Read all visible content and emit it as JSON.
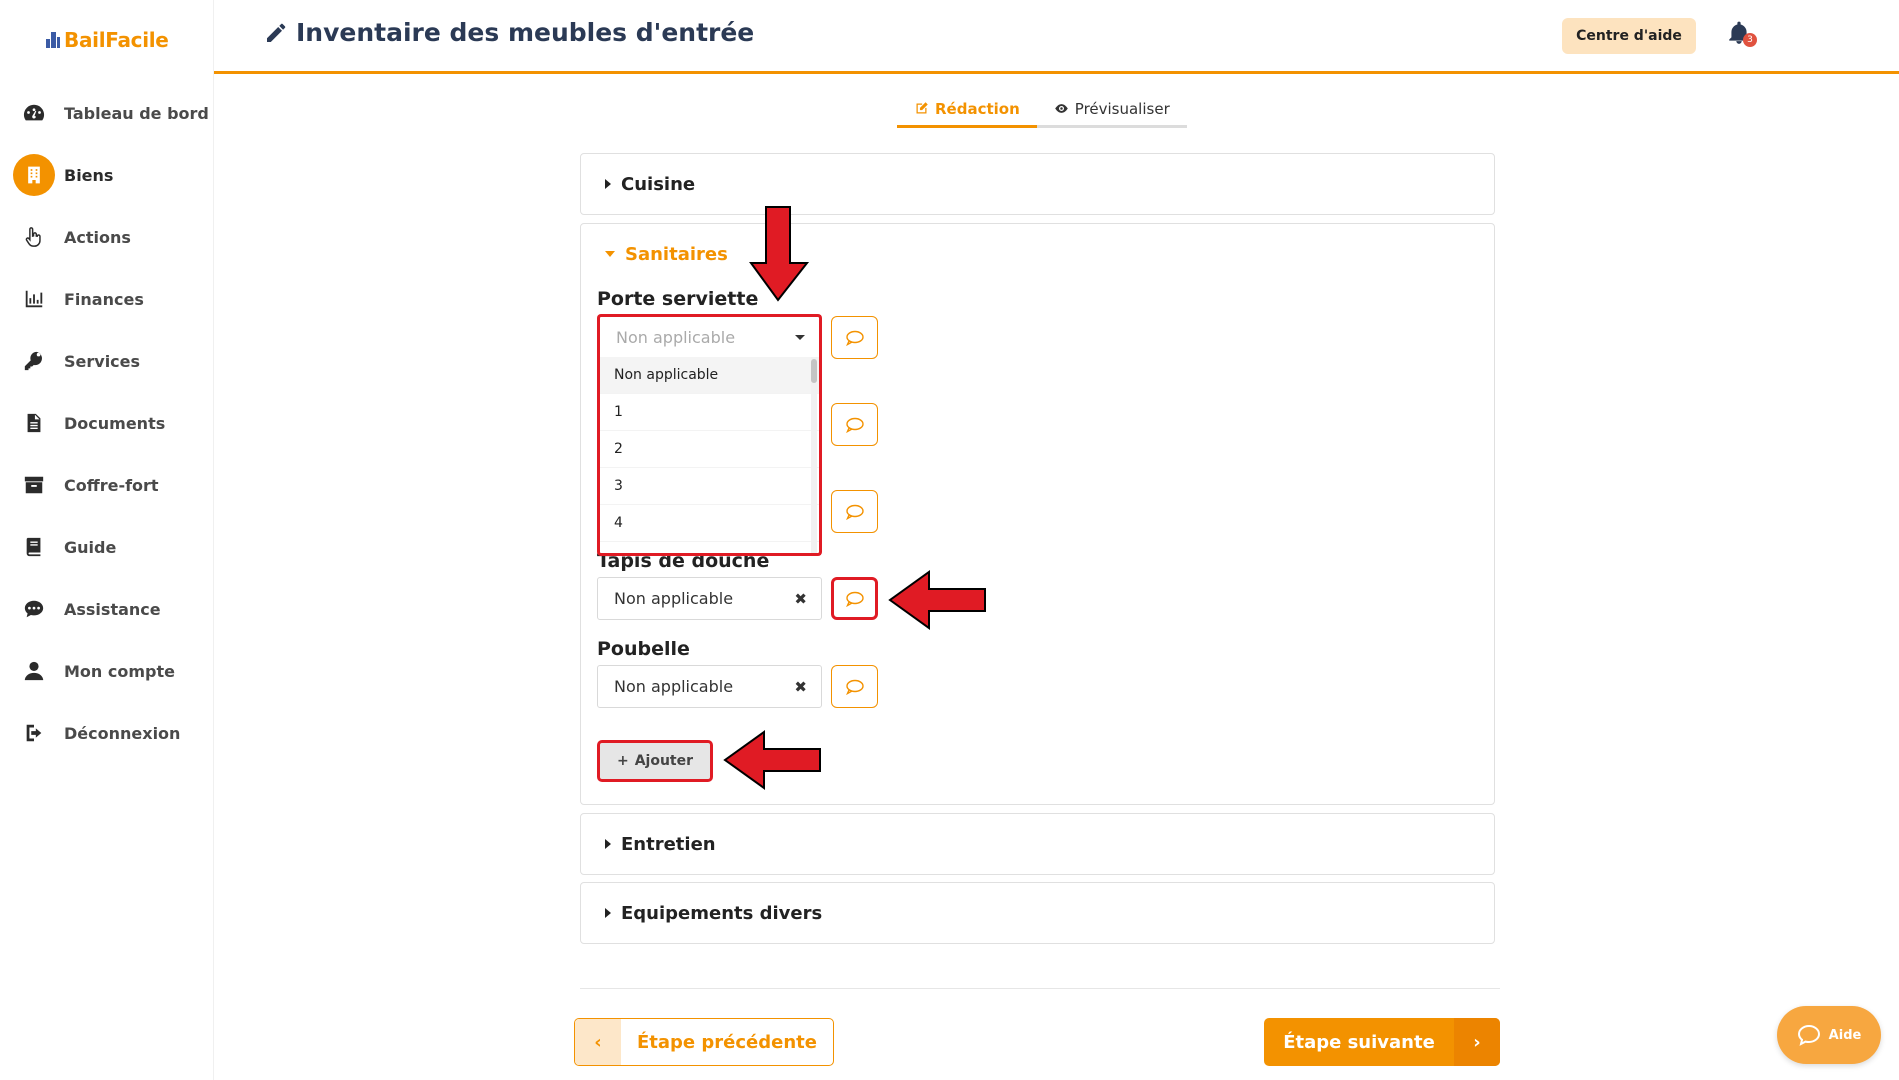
{
  "app": {
    "logo_text": "BailFacile"
  },
  "sidebar": {
    "items": [
      {
        "label": "Tableau de bord",
        "icon": "dashboard-icon"
      },
      {
        "label": "Biens",
        "icon": "building-icon",
        "active": true
      },
      {
        "label": "Actions",
        "icon": "pointer-hand-icon"
      },
      {
        "label": "Finances",
        "icon": "bar-chart-icon"
      },
      {
        "label": "Services",
        "icon": "key-icon"
      },
      {
        "label": "Documents",
        "icon": "document-icon"
      },
      {
        "label": "Coffre-fort",
        "icon": "archive-icon"
      },
      {
        "label": "Guide",
        "icon": "book-icon"
      },
      {
        "label": "Assistance",
        "icon": "chat-icon"
      },
      {
        "label": "Mon compte",
        "icon": "user-icon"
      },
      {
        "label": "Déconnexion",
        "icon": "logout-icon"
      }
    ]
  },
  "header": {
    "title": "Inventaire des meubles d'entrée",
    "help_label": "Centre d'aide",
    "notification_count": "3"
  },
  "tabs": [
    {
      "label": "Rédaction",
      "active": true
    },
    {
      "label": "Prévisualiser",
      "active": false
    }
  ],
  "sections": {
    "cuisine": "Cuisine",
    "sanitaires": "Sanitaires",
    "entretien": "Entretien",
    "equipements": "Equipements divers"
  },
  "fields": {
    "porte_serviette": {
      "label": "Porte serviette",
      "placeholder": "Non applicable"
    },
    "tapis": {
      "label": "Tapis de douche",
      "value": "Non applicable"
    },
    "poubelle": {
      "label": "Poubelle",
      "value": "Non applicable"
    }
  },
  "dropdown_options": [
    "Non applicable",
    "1",
    "2",
    "3",
    "4"
  ],
  "add_button": "Ajouter",
  "footer": {
    "prev_label": "Étape précédente",
    "next_label": "Étape suivante"
  },
  "aide_label": "Aide",
  "colors": {
    "accent": "#f39200",
    "highlight": "#e01b24",
    "title": "#2b3a55"
  }
}
